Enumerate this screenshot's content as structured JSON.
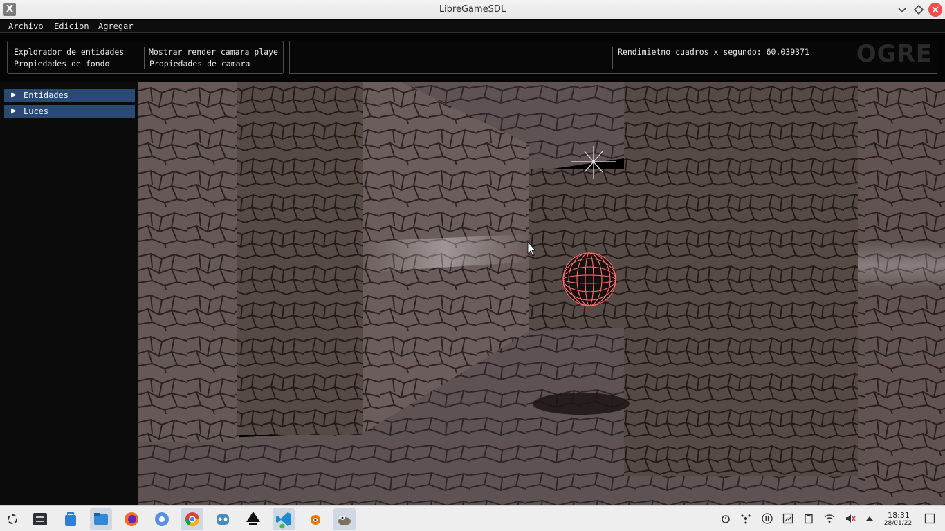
{
  "window": {
    "title": "LibreGameSDL",
    "app_icon": "X"
  },
  "menubar": {
    "items": [
      "Archivo",
      "Edicion",
      "Agregar"
    ]
  },
  "toolbar": {
    "explorer": "Explorador de entidades",
    "background_props": "Propiedades de fondo",
    "show_player_camera": "Mostrar render camara playe",
    "camera_props": "Propiedades de camara",
    "fps_label": "Rendimietno cuadros x segundo: 60.039371",
    "watermark": "OGRE"
  },
  "sidebar": {
    "nodes": [
      {
        "label": "Entidades",
        "icon": "triangle-right-icon"
      },
      {
        "label": "Luces",
        "icon": "triangle-right-icon"
      }
    ]
  },
  "taskbar": {
    "apps": [
      "application-launcher-icon",
      "system-settings-icon",
      "discover-store-icon",
      "file-manager-icon",
      "firefox-icon",
      "chromium-icon",
      "chrome-icon",
      "godot-icon",
      "inkscape-icon",
      "vscode-icon",
      "blender-icon",
      "gimp-icon"
    ],
    "tray": [
      "alarm-icon",
      "network-share-icon",
      "media-pause-icon",
      "screenshot-icon",
      "clipboard-icon",
      "wifi-icon",
      "volume-muted-icon",
      "tray-expand-icon"
    ],
    "clock": {
      "time": "18:31",
      "date": "28/01/22"
    }
  },
  "colors": {
    "accent": "#2a4a73",
    "close": "#ef4c4c"
  }
}
